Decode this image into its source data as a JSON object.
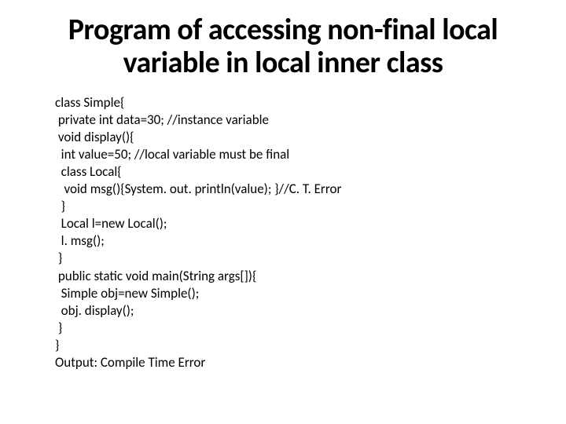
{
  "title": "Program of accessing non-final local variable in local inner class",
  "code_lines": [
    "class Simple{",
    " private int data=30; //instance variable",
    " void display(){",
    "  int value=50; //local variable must be final",
    "  class Local{",
    "   void msg(){System. out. println(value); }//C. T. Error",
    "  }",
    "  Local l=new Local();",
    "  l. msg();",
    " }",
    " public static void main(String args[]){",
    "  Simple obj=new Simple();",
    "  obj. display();",
    " }",
    "}",
    "Output: Compile Time Error"
  ]
}
